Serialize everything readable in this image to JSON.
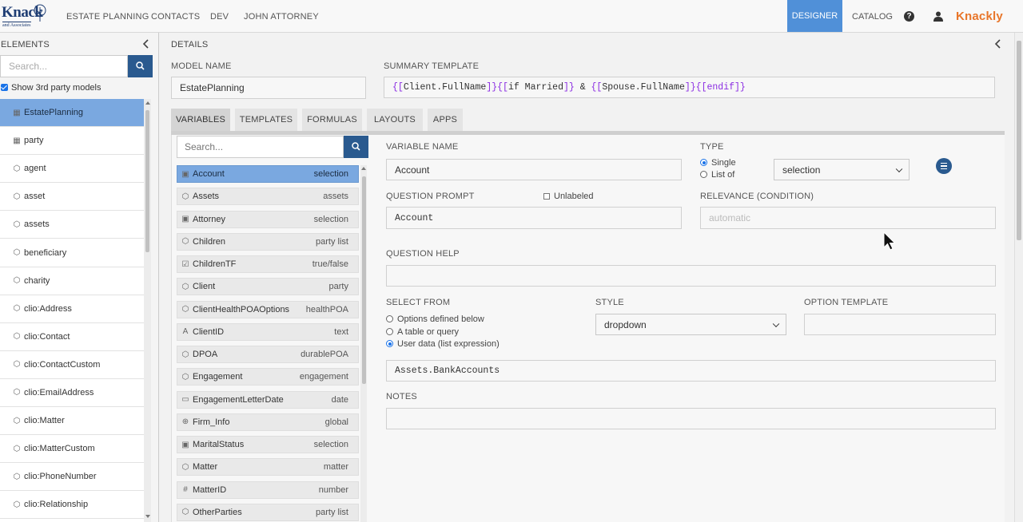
{
  "brand": {
    "logo_main": "Knack",
    "logo_sub": "and Associates",
    "product": "Knackly"
  },
  "topnav": {
    "links": [
      "ESTATE PLANNING",
      "CONTACTS",
      "DEV",
      "JOHN ATTORNEY"
    ],
    "designer": "DESIGNER",
    "catalog": "CATALOG"
  },
  "elements": {
    "title": "ELEMENTS",
    "search_placeholder": "Search...",
    "show_third_party": "Show 3rd party models",
    "items": [
      {
        "label": "EstatePlanning",
        "icon": "table-icon",
        "active": true
      },
      {
        "label": "party",
        "icon": "table-icon"
      },
      {
        "label": "agent",
        "icon": "cube-icon"
      },
      {
        "label": "asset",
        "icon": "cube-icon"
      },
      {
        "label": "assets",
        "icon": "cube-icon"
      },
      {
        "label": "beneficiary",
        "icon": "cube-icon"
      },
      {
        "label": "charity",
        "icon": "cube-icon"
      },
      {
        "label": "clio:Address",
        "icon": "cube-icon"
      },
      {
        "label": "clio:Contact",
        "icon": "cube-icon"
      },
      {
        "label": "clio:ContactCustom",
        "icon": "cube-icon"
      },
      {
        "label": "clio:EmailAddress",
        "icon": "cube-icon"
      },
      {
        "label": "clio:Matter",
        "icon": "cube-icon"
      },
      {
        "label": "clio:MatterCustom",
        "icon": "cube-icon"
      },
      {
        "label": "clio:PhoneNumber",
        "icon": "cube-icon"
      },
      {
        "label": "clio:Relationship",
        "icon": "cube-icon"
      }
    ]
  },
  "details": {
    "title": "DETAILS",
    "model_name_label": "MODEL NAME",
    "model_name": "EstatePlanning",
    "summary_label": "SUMMARY TEMPLATE",
    "summary_parts": [
      "{[",
      "Client.FullName",
      "]}",
      "{[",
      "if Married",
      "]}",
      " & ",
      "{[",
      "Spouse.FullName",
      "]}",
      "{[",
      "endif",
      "]}"
    ],
    "tabs": [
      "VARIABLES",
      "TEMPLATES",
      "FORMULAS",
      "LAYOUTS",
      "APPS"
    ]
  },
  "variables": {
    "search_placeholder": "Search...",
    "items": [
      {
        "name": "Account",
        "type": "selection",
        "icon": "select-icon",
        "active": true
      },
      {
        "name": "Assets",
        "type": "assets",
        "icon": "cube-icon"
      },
      {
        "name": "Attorney",
        "type": "selection",
        "icon": "select-icon"
      },
      {
        "name": "Children",
        "type": "party list",
        "icon": "cube-icon"
      },
      {
        "name": "ChildrenTF",
        "type": "true/false",
        "icon": "checkbox-icon"
      },
      {
        "name": "Client",
        "type": "party",
        "icon": "cube-icon"
      },
      {
        "name": "ClientHealthPOAOptions",
        "type": "healthPOA",
        "icon": "cube-icon"
      },
      {
        "name": "ClientID",
        "type": "text",
        "icon": "text-icon"
      },
      {
        "name": "DPOA",
        "type": "durablePOA",
        "icon": "cube-icon"
      },
      {
        "name": "Engagement",
        "type": "engagement",
        "icon": "cube-icon"
      },
      {
        "name": "EngagementLetterDate",
        "type": "date",
        "icon": "calendar-icon"
      },
      {
        "name": "Firm_Info",
        "type": "global",
        "icon": "globe-icon"
      },
      {
        "name": "MaritalStatus",
        "type": "selection",
        "icon": "select-icon"
      },
      {
        "name": "Matter",
        "type": "matter",
        "icon": "cube-icon"
      },
      {
        "name": "MatterID",
        "type": "number",
        "icon": "number-icon"
      },
      {
        "name": "OtherParties",
        "type": "party list",
        "icon": "cube-icon"
      }
    ]
  },
  "variable": {
    "name_label": "VARIABLE NAME",
    "name": "Account",
    "type_label": "TYPE",
    "type_single": "Single",
    "type_list": "List of",
    "type_value": "selection",
    "prompt_label": "QUESTION PROMPT",
    "unlabeled": "Unlabeled",
    "prompt": "Account",
    "relevance_label": "RELEVANCE (CONDITION)",
    "relevance_placeholder": "automatic",
    "help_label": "QUESTION HELP",
    "select_from_label": "SELECT FROM",
    "select_options": [
      "Options defined below",
      "A table or query",
      "User data (list expression)"
    ],
    "style_label": "STYLE",
    "style_value": "dropdown",
    "option_template_label": "OPTION TEMPLATE",
    "expression": "Assets.BankAccounts",
    "notes_label": "NOTES"
  },
  "colors": {
    "accent": "#5090d8",
    "selected_row": "#7aa8e0",
    "button": "#2a5a8f",
    "brand": "#e8762a",
    "template_bracket": "#8a2be2"
  }
}
